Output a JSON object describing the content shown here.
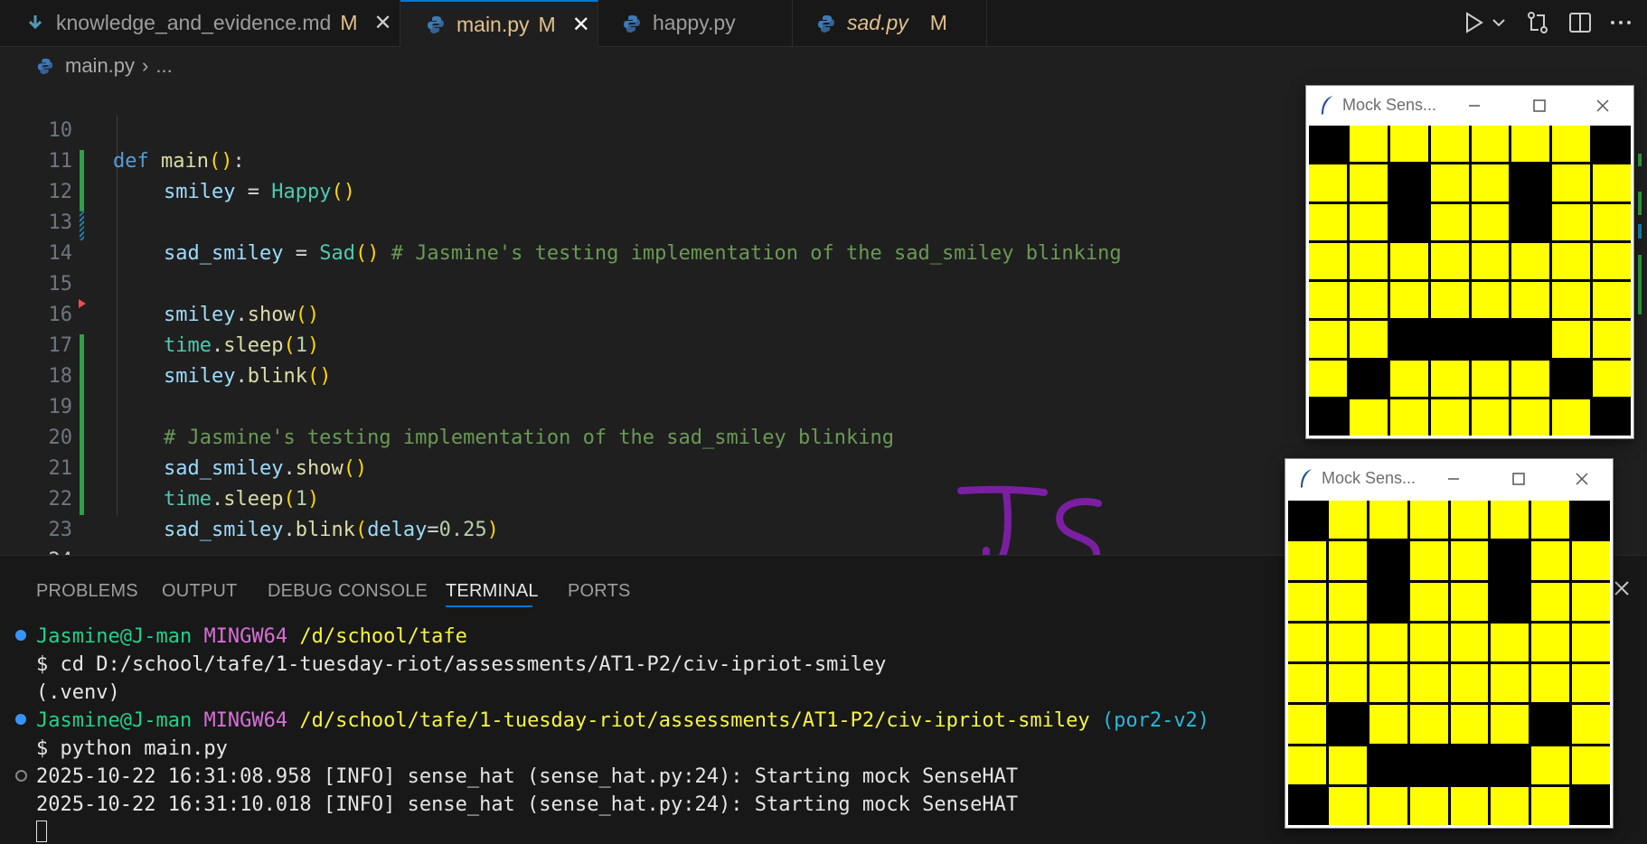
{
  "tabs": [
    {
      "label": "knowledge_and_evidence.md",
      "modified": "M",
      "close": "✕",
      "icon": "download-icon"
    },
    {
      "label": "main.py",
      "modified": "M",
      "close": "✕",
      "icon": "python-icon"
    },
    {
      "label": "happy.py",
      "icon": "python-icon"
    },
    {
      "label": "sad.py",
      "modified": "M",
      "icon": "python-icon"
    }
  ],
  "breadcrumb": {
    "file": "main.py",
    "sep": "›",
    "rest": "..."
  },
  "editor": {
    "line_numbers": [
      "10",
      "11",
      "12",
      "13",
      "14",
      "15",
      "16",
      "17",
      "18",
      "19",
      "20",
      "21",
      "22",
      "23",
      "24"
    ],
    "code": {
      "l10": {
        "kw": "def",
        "fn": "main",
        "open": "(",
        "close": ")",
        "colon": ":"
      },
      "l11": {
        "var": "smiley",
        "eq": " = ",
        "cls": "Happy",
        "parens": "()"
      },
      "l13": {
        "var": "sad_smiley",
        "eq": " = ",
        "cls": "Sad",
        "parens": "()",
        "comment": " # Jasmine's testing implementation of the sad_smiley blinking"
      },
      "l15": {
        "var": "smiley",
        "dot": ".",
        "fn": "show",
        "parens": "()"
      },
      "l16": {
        "var": "time",
        "dot": ".",
        "fn": "sleep",
        "open": "(",
        "num": "1",
        "close": ")"
      },
      "l17": {
        "var": "smiley",
        "dot": ".",
        "fn": "blink",
        "parens": "()"
      },
      "l19": {
        "comment": "# Jasmine's testing implementation of the sad_smiley blinking"
      },
      "l20": {
        "var": "sad_smiley",
        "dot": ".",
        "fn": "show",
        "parens": "()"
      },
      "l21": {
        "var": "time",
        "dot": ".",
        "fn": "sleep",
        "open": "(",
        "num": "1",
        "close": ")"
      },
      "l22": {
        "var": "sad_smiley",
        "dot": ".",
        "fn": "blink",
        "open": "(",
        "param": "delay",
        "eq": "=",
        "num": "0.25",
        "close": ")"
      }
    }
  },
  "panel": {
    "tabs": [
      "PROBLEMS",
      "OUTPUT",
      "DEBUG CONSOLE",
      "TERMINAL",
      "PORTS"
    ],
    "active_tab": "TERMINAL",
    "terminal": {
      "p1_user": "Jasmine@J-man",
      "p1_host": "MINGW64",
      "p1_path": "/d/school/tafe",
      "cmd1": "$ cd D:/school/tafe/1-tuesday-riot/assessments/AT1-P2/civ-ipriot-smiley",
      "venv": "(.venv)",
      "p2_user": "Jasmine@J-man",
      "p2_host": "MINGW64",
      "p2_path": "/d/school/tafe/1-tuesday-riot/assessments/AT1-P2/civ-ipriot-smiley",
      "p2_branch": "(por2-v2)",
      "cmd2": "$ python main.py",
      "log1": "2025-10-22 16:31:08.958 [INFO] sense_hat (sense_hat.py:24): Starting mock SenseHAT",
      "log2": "2025-10-22 16:31:10.018 [INFO] sense_hat (sense_hat.py:24): Starting mock SenseHAT"
    }
  },
  "annotation": "Js",
  "mock_windows": [
    {
      "title": "Mock Sens...",
      "pixels": [
        "01111110",
        "11011011",
        "11011011",
        "11111111",
        "11111111",
        "11000011",
        "10111101",
        "01111110"
      ]
    },
    {
      "title": "Mock Sens...",
      "pixels": [
        "01111110",
        "11011011",
        "11011011",
        "11111111",
        "11111111",
        "10111101",
        "11000011",
        "01111110"
      ]
    }
  ],
  "colors": {
    "pixel_on": "#ffff00",
    "pixel_off": "#000000",
    "accent": "#0078d4",
    "annotation": "#7b1fa2"
  }
}
